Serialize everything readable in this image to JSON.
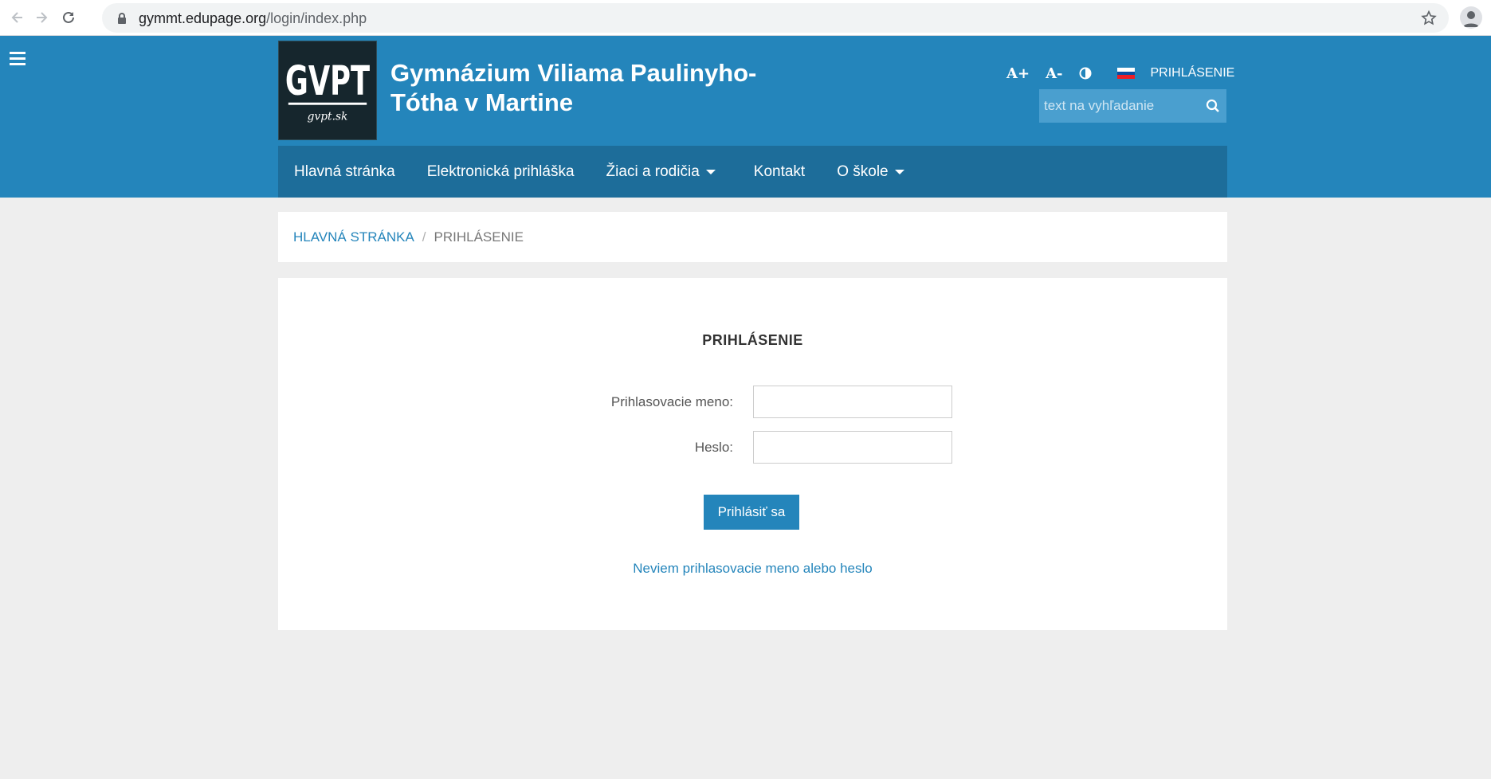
{
  "browser": {
    "url_host": "gymmt.edupage.org",
    "url_path": "/login/index.php"
  },
  "header": {
    "title_line1": "Gymnázium Viliama Paulinyho-",
    "title_line2": "Tótha v Martine",
    "logo_text": "GVPT",
    "logo_subtext": "gvpt.sk",
    "font_increase": "A+",
    "font_decrease": "A-",
    "login_label": "PRIHLÁSENIE",
    "search_placeholder": "text na vyhľadanie",
    "flag_colors": [
      "#ffffff",
      "#0b4ea2",
      "#ee1c25"
    ]
  },
  "menu": {
    "items": [
      {
        "label": "Hlavná stránka"
      },
      {
        "label": "Elektronická prihláška"
      },
      {
        "label": "Žiaci a rodičia"
      },
      {
        "label": "Kontakt"
      },
      {
        "label": "O škole"
      }
    ]
  },
  "breadcrumb": {
    "home": "HLAVNÁ STRÁNKA",
    "separator": "/",
    "current": "PRIHLÁSENIE"
  },
  "login": {
    "title": "PRIHLÁSENIE",
    "username_label": "Prihlasovacie meno:",
    "username_value": "",
    "password_label": "Heslo:",
    "password_value": "",
    "submit_label": "Prihlásiť sa",
    "forgot_link": "Neviem prihlasovacie meno alebo heslo"
  },
  "colors": {
    "header_bg": "#2485bb",
    "menu_bg": "#1d6d9a",
    "accent": "#2485bb",
    "page_bg": "#eeeeee"
  }
}
